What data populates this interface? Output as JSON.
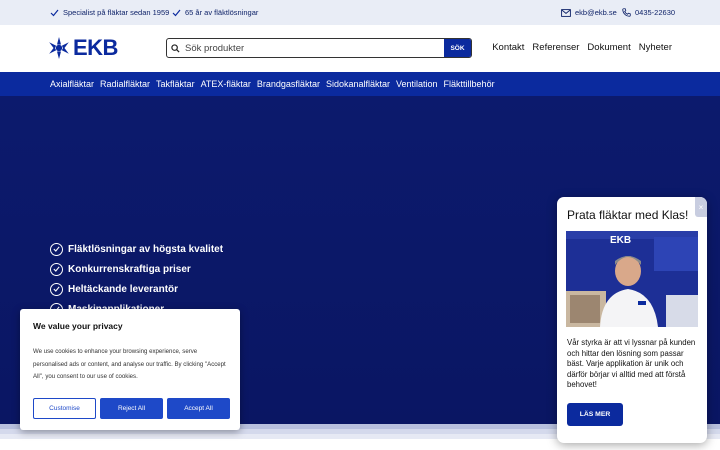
{
  "topbar": {
    "claim1": "Specialist på fläktar sedan 1959",
    "claim2": "65 år av fläktlösningar",
    "email": "ekb@ekb.se",
    "phone": "0435-22630"
  },
  "header": {
    "logo_text": "EKB",
    "search_placeholder": "Sök produkter",
    "search_button": "SÖK",
    "nav": [
      "Kontakt",
      "Referenser",
      "Dokument",
      "Nyheter"
    ]
  },
  "categories": [
    "Axialfläktar",
    "Radialfläktar",
    "Takfläktar",
    "ATEX-fläktar",
    "Brandgasfläktar",
    "Sidokanalfläktar",
    "Ventilation",
    "Fläkttillbehör"
  ],
  "hero": {
    "usps": [
      "Fläktlösningar av högsta kvalitet",
      "Konkurrenskraftiga priser",
      "Heltäckande leverantör",
      "Maskinapplikationer"
    ]
  },
  "cookie": {
    "title": "We value your privacy",
    "body": "We use cookies to enhance your browsing experience, serve personalised ads or content, and analyse our traffic. By clicking \"Accept All\", you consent to our use of cookies.",
    "customise": "Customise",
    "reject": "Reject All",
    "accept": "Accept All"
  },
  "chat": {
    "title": "Prata fläktar med Klas!",
    "image_logo_text": "EKB",
    "text": "Vår styrka är att vi lyssnar på kunden och hittar den lösning som passar bäst. Varje applikation är unik och därför börjar vi alltid med att förstå behovet!",
    "button": "LÄS MER",
    "close": "×"
  },
  "colors": {
    "brand_blue": "#0b2a9e",
    "hero_navy": "#0a1866",
    "accent_button": "#1e49c8"
  }
}
